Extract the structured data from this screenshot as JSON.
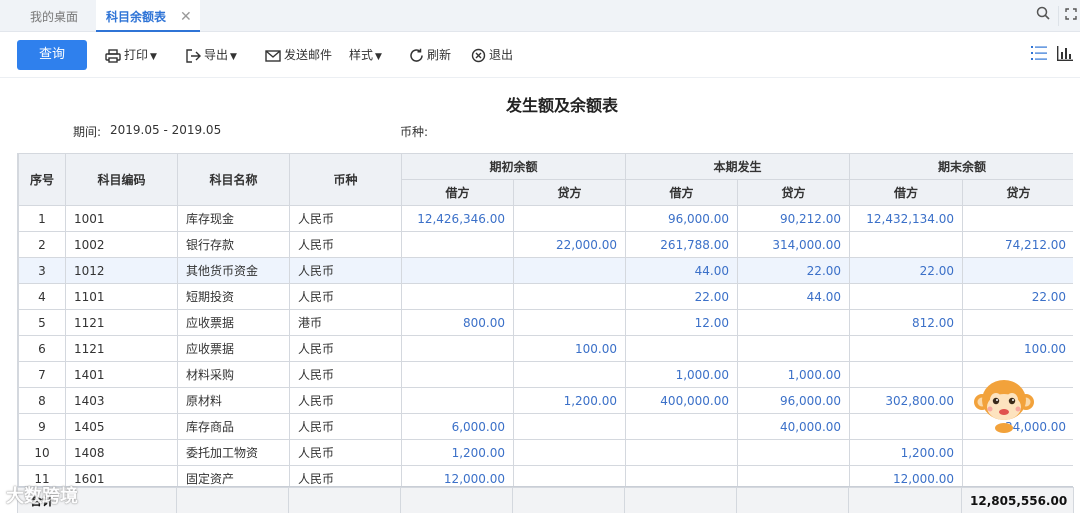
{
  "tabs": [
    {
      "label": "我的桌面"
    },
    {
      "label": "科目余额表",
      "close": "✕"
    }
  ],
  "toolbar": {
    "query": "查询",
    "print": "打印",
    "export": "导出",
    "email": "发送邮件",
    "style": "样式",
    "refresh": "刷新",
    "exit": "退出"
  },
  "report": {
    "title": "发生额及余额表",
    "period_label": "期间:",
    "period_value": "2019.05 - 2019.05",
    "currency_label": "币种:"
  },
  "table": {
    "headers": {
      "seq": "序号",
      "code": "科目编码",
      "name": "科目名称",
      "currency": "币种",
      "opening": "期初余额",
      "current": "本期发生",
      "closing": "期末余额",
      "debit": "借方",
      "credit": "贷方"
    },
    "rows": [
      {
        "seq": "1",
        "code": "1001",
        "name": "库存现金",
        "currency": "人民币",
        "od": "12,426,346.00",
        "oc": "",
        "cd": "96,000.00",
        "cc": "90,212.00",
        "ed": "12,432,134.00",
        "ec": ""
      },
      {
        "seq": "2",
        "code": "1002",
        "name": "银行存款",
        "currency": "人民币",
        "od": "",
        "oc": "22,000.00",
        "cd": "261,788.00",
        "cc": "314,000.00",
        "ed": "",
        "ec": "74,212.00"
      },
      {
        "seq": "3",
        "code": "1012",
        "name": "其他货币资金",
        "currency": "人民币",
        "od": "",
        "oc": "",
        "cd": "44.00",
        "cc": "22.00",
        "ed": "22.00",
        "ec": ""
      },
      {
        "seq": "4",
        "code": "1101",
        "name": "短期投资",
        "currency": "人民币",
        "od": "",
        "oc": "",
        "cd": "22.00",
        "cc": "44.00",
        "ed": "",
        "ec": "22.00"
      },
      {
        "seq": "5",
        "code": "1121",
        "name": "应收票据",
        "currency": "港币",
        "od": "800.00",
        "oc": "",
        "cd": "12.00",
        "cc": "",
        "ed": "812.00",
        "ec": ""
      },
      {
        "seq": "6",
        "code": "1121",
        "name": "应收票据",
        "currency": "人民币",
        "od": "",
        "oc": "100.00",
        "cd": "",
        "cc": "",
        "ed": "",
        "ec": "100.00"
      },
      {
        "seq": "7",
        "code": "1401",
        "name": "材料采购",
        "currency": "人民币",
        "od": "",
        "oc": "",
        "cd": "1,000.00",
        "cc": "1,000.00",
        "ed": "",
        "ec": ""
      },
      {
        "seq": "8",
        "code": "1403",
        "name": "原材料",
        "currency": "人民币",
        "od": "",
        "oc": "1,200.00",
        "cd": "400,000.00",
        "cc": "96,000.00",
        "ed": "302,800.00",
        "ec": ""
      },
      {
        "seq": "9",
        "code": "1405",
        "name": "库存商品",
        "currency": "人民币",
        "od": "6,000.00",
        "oc": "",
        "cd": "",
        "cc": "40,000.00",
        "ed": "",
        "ec": "34,000.00"
      },
      {
        "seq": "10",
        "code": "1408",
        "name": "委托加工物资",
        "currency": "人民币",
        "od": "1,200.00",
        "oc": "",
        "cd": "",
        "cc": "",
        "ed": "1,200.00",
        "ec": ""
      },
      {
        "seq": "11",
        "code": "1601",
        "name": "固定资产",
        "currency": "人民币",
        "od": "12,000.00",
        "oc": "",
        "cd": "",
        "cc": "",
        "ed": "12,000.00",
        "ec": ""
      }
    ],
    "total": {
      "label": "合计",
      "value": "12,805,556.00"
    }
  },
  "watermark": "大数跨境",
  "icons": {
    "search": "search-icon",
    "fullscreen": "fullscreen-icon",
    "list_view": "list-view-icon",
    "chart_view": "chart-view-icon"
  },
  "colors": {
    "accent": "#2f80ed",
    "number_text": "#3b70c8",
    "header_bg": "#eef1f5",
    "selected_row": "#eef4fd"
  }
}
